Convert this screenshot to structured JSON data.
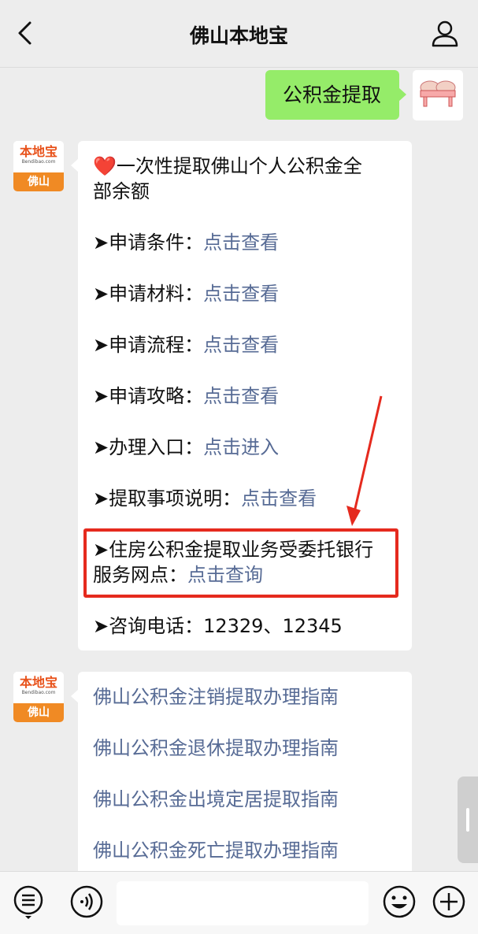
{
  "header": {
    "title": "佛山本地宝"
  },
  "avatar": {
    "logo_text": "本地宝",
    "logo_sub": "Bendibao.com",
    "city": "佛山"
  },
  "user_message": "公积金提取",
  "bubble1": {
    "headline_line1": "一次性提取佛山个人公积金全",
    "headline_line2": "部余额",
    "items": [
      {
        "label": "➤申请条件：",
        "link": "点击查看"
      },
      {
        "label": "➤申请材料：",
        "link": "点击查看"
      },
      {
        "label": "➤申请流程：",
        "link": "点击查看"
      },
      {
        "label": "➤申请攻略：",
        "link": "点击查看"
      },
      {
        "label": "➤办理入口：",
        "link": "点击进入"
      },
      {
        "label": "➤提取事项说明：",
        "link": "点击查看"
      }
    ],
    "highlight_line1": "➤住房公积金提取业务受委托银行",
    "highlight_line2_label": "服务网点：",
    "highlight_line2_link": "点击查询",
    "phone": "➤咨询电话：12329、12345"
  },
  "bubble2": {
    "links": [
      "佛山公积金注销提取办理指南",
      "佛山公积金退休提取办理指南",
      "佛山公积金出境定居提取指南",
      "佛山公积金死亡提取办理指南"
    ]
  },
  "colors": {
    "link": "#576b95",
    "user_bubble": "#95ec69",
    "highlight": "#e52a1e"
  },
  "icons": [
    "back-icon",
    "profile-icon",
    "menu-icon",
    "voice-icon",
    "emoji-icon",
    "add-icon",
    "heart-icon"
  ]
}
